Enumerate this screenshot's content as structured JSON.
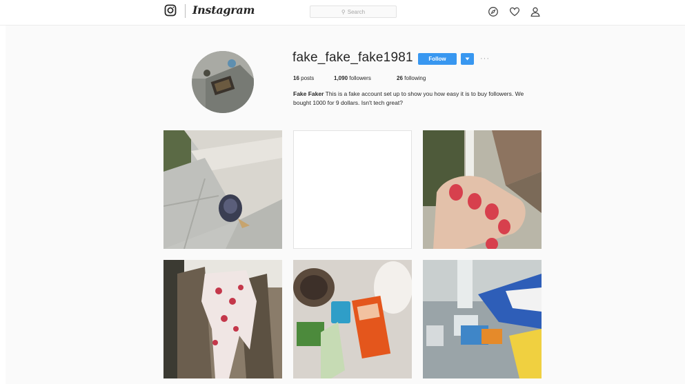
{
  "nav": {
    "brand": "Instagram",
    "search_placeholder": "Search",
    "icons": [
      "instagram-glyph-icon",
      "compass-icon",
      "heart-icon",
      "person-icon"
    ]
  },
  "profile": {
    "username": "fake_fake_fake1981",
    "follow_label": "Follow",
    "more_label": "···",
    "stats": {
      "posts_count": "16",
      "posts_label": "posts",
      "followers_count": "1,090",
      "followers_label": "followers",
      "following_count": "26",
      "following_label": "following"
    },
    "bio_name": "Fake Faker",
    "bio_text": " This is a fake account set up to show you how easy it is to buy followers. We bought 1000 for 9 dollars. Isn't tech great?"
  },
  "colors": {
    "accent": "#3897f0",
    "page_bg": "#fafafa",
    "text": "#262626",
    "muted": "#999999"
  },
  "posts": [
    {
      "id": "post-1",
      "subject": "sidewalk-with-trash"
    },
    {
      "id": "post-2",
      "subject": "blank-white"
    },
    {
      "id": "post-3",
      "subject": "painted-nails-cigarette"
    },
    {
      "id": "post-4",
      "subject": "floral-shirt-on-chair"
    },
    {
      "id": "post-5",
      "subject": "toiletries-on-carpet"
    },
    {
      "id": "post-6",
      "subject": "chips-and-boxes-on-table"
    }
  ]
}
